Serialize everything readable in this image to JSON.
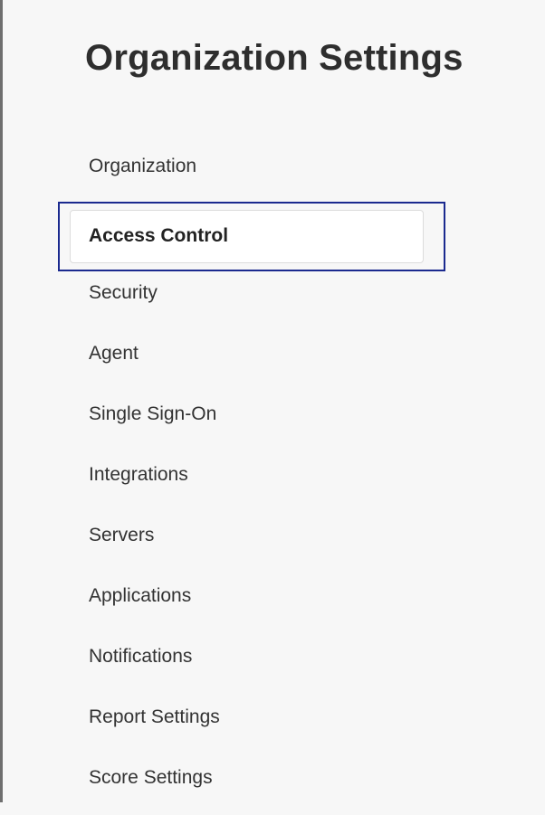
{
  "page": {
    "title": "Organization Settings"
  },
  "sidebar": {
    "items": [
      {
        "label": "Organization",
        "active": false
      },
      {
        "label": "Access Control",
        "active": true
      },
      {
        "label": "Security",
        "active": false
      },
      {
        "label": "Agent",
        "active": false
      },
      {
        "label": "Single Sign-On",
        "active": false
      },
      {
        "label": "Integrations",
        "active": false
      },
      {
        "label": "Servers",
        "active": false
      },
      {
        "label": "Applications",
        "active": false
      },
      {
        "label": "Notifications",
        "active": false
      },
      {
        "label": "Report Settings",
        "active": false
      },
      {
        "label": "Score Settings",
        "active": false
      }
    ]
  },
  "colors": {
    "page_background": "#f7f7f7",
    "active_outline": "#1b2a8f",
    "active_card": "#ffffff",
    "text": "#333333"
  }
}
